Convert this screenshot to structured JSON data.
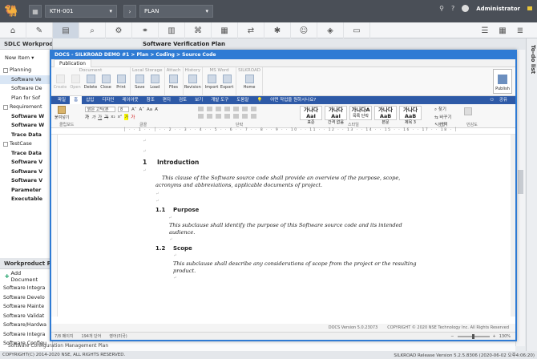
{
  "topbar": {
    "project": "KTH-001",
    "phase": "PLAN",
    "user": "Administrator"
  },
  "left": {
    "title": "SDLC Workproduct",
    "new_item": "New Item",
    "tree": [
      {
        "label": "Planning",
        "bold": false,
        "level": 0
      },
      {
        "label": "Software Ve",
        "bold": false,
        "level": 1,
        "selected": true
      },
      {
        "label": "Software De",
        "bold": false,
        "level": 1
      },
      {
        "label": "Plan for Sof",
        "bold": false,
        "level": 1
      },
      {
        "label": "Requirement",
        "bold": false,
        "level": 0
      },
      {
        "label": "Software W",
        "bold": true,
        "level": 1
      },
      {
        "label": "Software W",
        "bold": true,
        "level": 1
      },
      {
        "label": "Trace Data",
        "bold": true,
        "level": 1
      },
      {
        "label": "TestCase",
        "bold": false,
        "level": 0
      },
      {
        "label": "Trace Data",
        "bold": true,
        "level": 1
      },
      {
        "label": "Software V",
        "bold": true,
        "level": 1
      },
      {
        "label": "Software V",
        "bold": true,
        "level": 1
      },
      {
        "label": "Software V",
        "bold": true,
        "level": 1
      },
      {
        "label": "Parameter",
        "bold": true,
        "level": 1
      },
      {
        "label": "Executable",
        "bold": true,
        "level": 1
      }
    ],
    "report_title": "Workproduct Repo",
    "add_document": "Add Document",
    "report_items": [
      "Software Integra",
      "Software Develo",
      "Software Mainte",
      "Software Validat",
      "Software/Hardwa",
      "Software Integra",
      "Software Configu"
    ]
  },
  "center_title": "Software Verification Plan",
  "todo": "To-do list",
  "footer": {
    "left": "COPYRIGHT(C) 2014-2020 NSE, ALL RIGHTS RESERVED.",
    "config": "Software Configuration Management Plan",
    "right": "SILKROAD Release Version 5.2.5.8306 (2020-06-02 오후4:06:20)"
  },
  "docs": {
    "title": "DOCS - SILKROAD DEMO #1 > Plan > Coding > Source Code",
    "tab": "Publication",
    "groups": [
      {
        "label": "Document",
        "buttons": [
          {
            "t": "Create",
            "dis": true
          },
          {
            "t": "Open",
            "dis": true
          },
          {
            "t": "Delete"
          },
          {
            "t": "Close"
          },
          {
            "t": "Print"
          }
        ]
      },
      {
        "label": "Local Storage",
        "buttons": [
          {
            "t": "Save"
          },
          {
            "t": "Load"
          }
        ]
      },
      {
        "label": "Attach",
        "buttons": [
          {
            "t": "Files"
          }
        ]
      },
      {
        "label": "History",
        "buttons": [
          {
            "t": "Revision"
          }
        ]
      },
      {
        "label": "MS Word",
        "buttons": [
          {
            "t": "Import"
          },
          {
            "t": "Export"
          }
        ]
      },
      {
        "label": "SILKROAD",
        "buttons": [
          {
            "t": "Home"
          }
        ]
      }
    ],
    "publish": "Publish",
    "hangul_tabs": [
      "파일",
      "홈",
      "삽입",
      "디자인",
      "레이아웃",
      "참조",
      "편지",
      "검토",
      "보기",
      "개발 도구",
      "도움말"
    ],
    "hangul_search": "어떤 작업을 원하시나요?",
    "share": "공유",
    "font": "맑은 고딕(본",
    "size": "8",
    "paste": "붙여넣기",
    "styles": [
      {
        "big": "가나다AaI",
        "small": "표준"
      },
      {
        "big": "가나다AaI",
        "small": "간격 없음"
      },
      {
        "big": "가나다A",
        "small": "목록 단락"
      },
      {
        "big": "가나다AaB",
        "small": "본문"
      },
      {
        "big": "가나다AaB",
        "small": "제목 3"
      }
    ],
    "find": "찾기",
    "replace": "바꾸기",
    "select": "선택",
    "group_labels": [
      "클립보드",
      "글꼴",
      "단락",
      "스타일",
      "편집",
      "민감도"
    ],
    "heading1_num": "1",
    "heading1": "Introduction",
    "intro_para": "This clause of the Software source code shall provide an overview of the purpose, scope, acronyms and abbreviations, applicable documents of project.",
    "h11_num": "1.1",
    "h11": "Purpose",
    "purpose_para": "This subclause shall identify the purpose of this Software source code and its intended audience.",
    "h12_num": "1.2",
    "h12": "Scope",
    "scope_para": "This subclause shall describe any considerations of scope from the project or the resulting product.",
    "status_pages": "7/8 페이지",
    "status_words": "194개 단어",
    "status_lang": "영어(미국)",
    "zoom": "130%",
    "copyright": "COPYRIGHT © 2020 NSE Technology Inc. All Rights Reserved",
    "version": "DOCS Version 5.0.23073"
  }
}
